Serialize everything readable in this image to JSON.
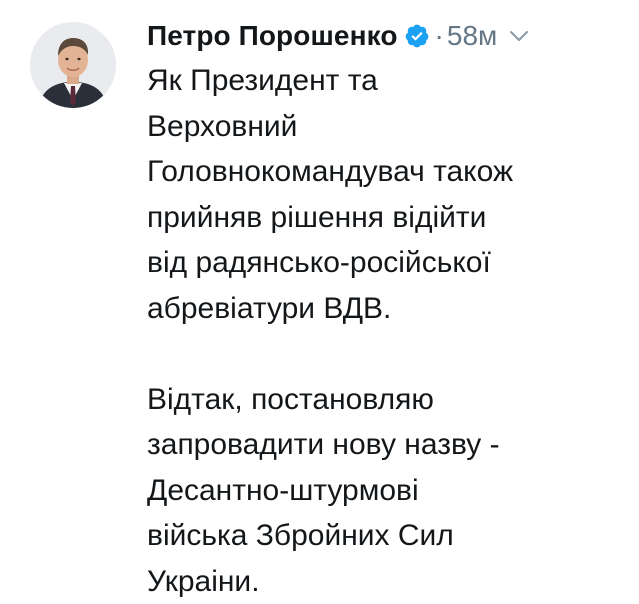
{
  "tweet": {
    "author_name": "Петро Порошенко",
    "verified_icon": "verified-badge-icon",
    "separator": "·",
    "timestamp": "58м",
    "menu_icon": "chevron-down-icon",
    "avatar_icon": "profile-photo",
    "paragraphs": [
      {
        "lines": [
          "Як Президент та",
          "Верховний",
          "Головнокомандувач також",
          "прийняв рішення відійти",
          "від радянсько-російської",
          "абревіатури ВДВ."
        ]
      },
      {
        "lines": [
          "Відтак, постановляю",
          "запровадити нову назву -",
          "Десантно-штурмові",
          "війська Збройних Сил",
          "Украіни."
        ]
      }
    ]
  },
  "colors": {
    "text": "#14171a",
    "muted": "#657786",
    "verified_blue": "#1da1f2"
  }
}
